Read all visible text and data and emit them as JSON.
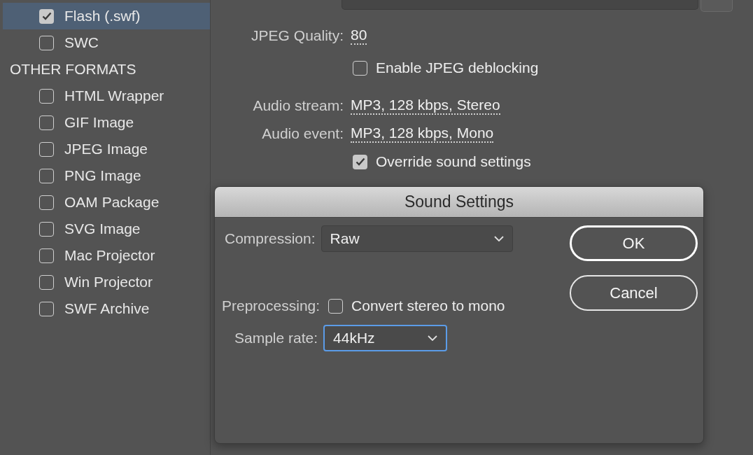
{
  "sidebar": {
    "items": [
      {
        "label": "Flash (.swf)",
        "checked": true,
        "selected": true
      },
      {
        "label": "SWC",
        "checked": false,
        "selected": false
      }
    ],
    "other_formats": {
      "title": "OTHER FORMATS",
      "items": [
        {
          "label": "HTML Wrapper",
          "checked": false,
          "selected": false
        },
        {
          "label": "GIF Image",
          "checked": false,
          "selected": false
        },
        {
          "label": "JPEG Image",
          "checked": false,
          "selected": false
        },
        {
          "label": "PNG Image",
          "checked": false,
          "selected": false
        },
        {
          "label": "OAM Package",
          "checked": false,
          "selected": false
        },
        {
          "label": "SVG Image",
          "checked": false,
          "selected": false
        },
        {
          "label": "Mac Projector",
          "checked": false,
          "selected": false
        },
        {
          "label": "Win Projector",
          "checked": false,
          "selected": false
        },
        {
          "label": "SWF Archive",
          "checked": false,
          "selected": false
        }
      ]
    }
  },
  "settings": {
    "jpeg_quality": {
      "label": "JPEG Quality:",
      "value": "80"
    },
    "deblocking": {
      "label": "Enable JPEG deblocking",
      "checked": false
    },
    "audio_stream": {
      "label": "Audio stream:",
      "value": "MP3, 128 kbps, Stereo"
    },
    "audio_event": {
      "label": "Audio event:",
      "value": "MP3, 128 kbps, Mono"
    },
    "override_sound": {
      "label": "Override sound settings",
      "checked": true
    }
  },
  "dialog": {
    "title": "Sound Settings",
    "compression": {
      "label": "Compression:",
      "value": "Raw",
      "focused": false
    },
    "preprocessing": {
      "label": "Preprocessing:",
      "checkbox_label": "Convert stereo to mono",
      "checked": false
    },
    "sample_rate": {
      "label": "Sample rate:",
      "value": "44kHz",
      "focused": true
    },
    "buttons": [
      {
        "label": "OK",
        "default": true
      },
      {
        "label": "Cancel",
        "default": false
      }
    ]
  }
}
